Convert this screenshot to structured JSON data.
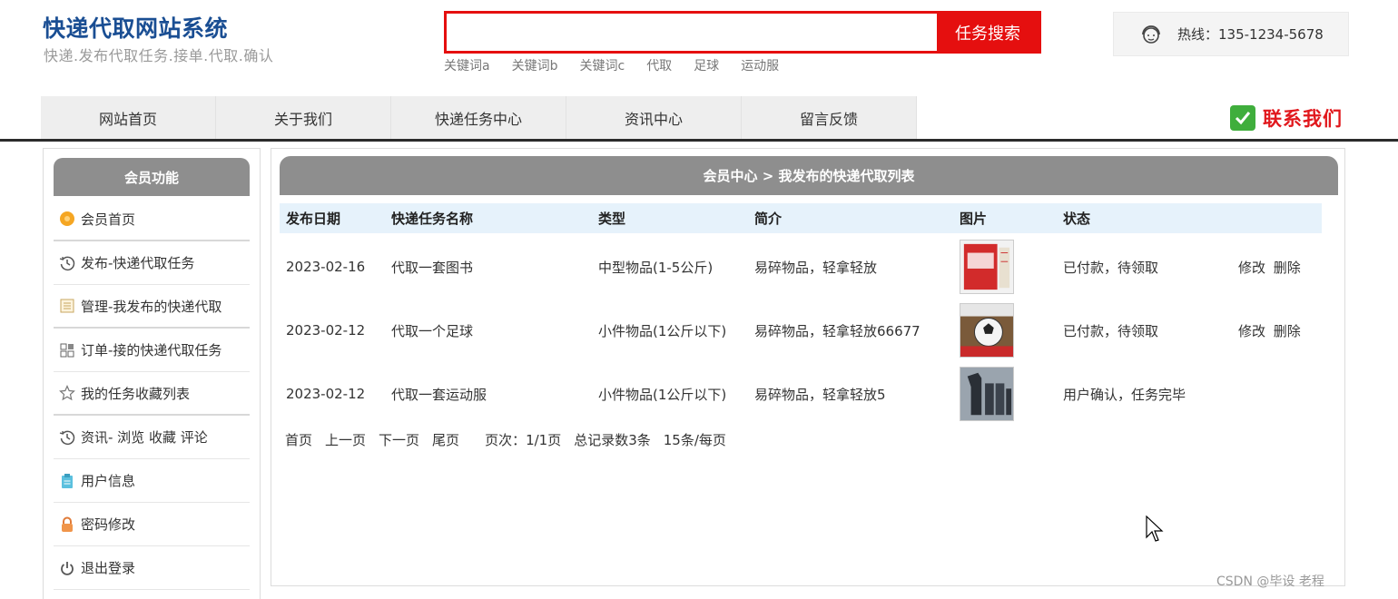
{
  "header": {
    "site_title": "快递代取网站系统",
    "site_subtitle": "快递.发布代取任务.接单.代取.确认",
    "search": {
      "placeholder": "",
      "button": "任务搜索"
    },
    "keywords": [
      "关键词a",
      "关键词b",
      "关键词c",
      "代取",
      "足球",
      "运动服"
    ],
    "hotline": "热线：135-1234-5678"
  },
  "nav": {
    "items": [
      "网站首页",
      "关于我们",
      "快递任务中心",
      "资讯中心",
      "留言反馈"
    ],
    "contact": "联系我们"
  },
  "sidebar": {
    "title": "会员功能",
    "items": [
      {
        "label": "会员首页",
        "icon": "orange-dot-icon"
      },
      {
        "label": "发布-快递代取任务",
        "icon": "history-icon"
      },
      {
        "label": "管理-我发布的快递代取",
        "icon": "list-doc-icon"
      },
      {
        "label": "订单-接的快递代取任务",
        "icon": "grid-icon"
      },
      {
        "label": "我的任务收藏列表",
        "icon": "star-icon"
      },
      {
        "label": "资讯- 浏览  收藏  评论",
        "icon": "history-icon"
      },
      {
        "label": "用户信息",
        "icon": "clipboard-icon"
      },
      {
        "label": "密码修改",
        "icon": "lock-icon"
      },
      {
        "label": "退出登录",
        "icon": "power-icon"
      }
    ]
  },
  "main": {
    "breadcrumb": "会员中心 > 我发布的快递代取列表",
    "columns": [
      "发布日期",
      "快递任务名称",
      "类型",
      "简介",
      "图片",
      "状态"
    ],
    "rows": [
      {
        "date": "2023-02-16",
        "name": "代取一套图书",
        "type": "中型物品(1-5公斤)",
        "desc": "易碎物品，轻拿轻放",
        "image": "book-image",
        "status": "已付款，待领取",
        "edit": "修改",
        "delete": "删除"
      },
      {
        "date": "2023-02-12",
        "name": "代取一个足球",
        "type": "小件物品(1公斤以下)",
        "desc": "易碎物品，轻拿轻放66677",
        "image": "football-image",
        "status": "已付款，待领取",
        "edit": "修改",
        "delete": "删除"
      },
      {
        "date": "2023-02-12",
        "name": "代取一套运动服",
        "type": "小件物品(1公斤以下)",
        "desc": "易碎物品，轻拿轻放5",
        "image": "sportswear-image",
        "status": "用户确认，任务完毕",
        "edit": "",
        "delete": ""
      }
    ],
    "pager": {
      "first": "首页",
      "prev": "上一页",
      "next": "下一页",
      "last": "尾页",
      "page_info": "页次：1/1页",
      "total": "总记录数3条",
      "per_page": "15条/每页"
    }
  },
  "watermark": "CSDN @毕设 老程",
  "colors": {
    "brand_blue": "#1a4e93",
    "search_red": "#e50f0f",
    "contact_red": "#e1181d",
    "header_gray": "#8e8e8e",
    "table_head_bg": "#e6f2fb"
  }
}
